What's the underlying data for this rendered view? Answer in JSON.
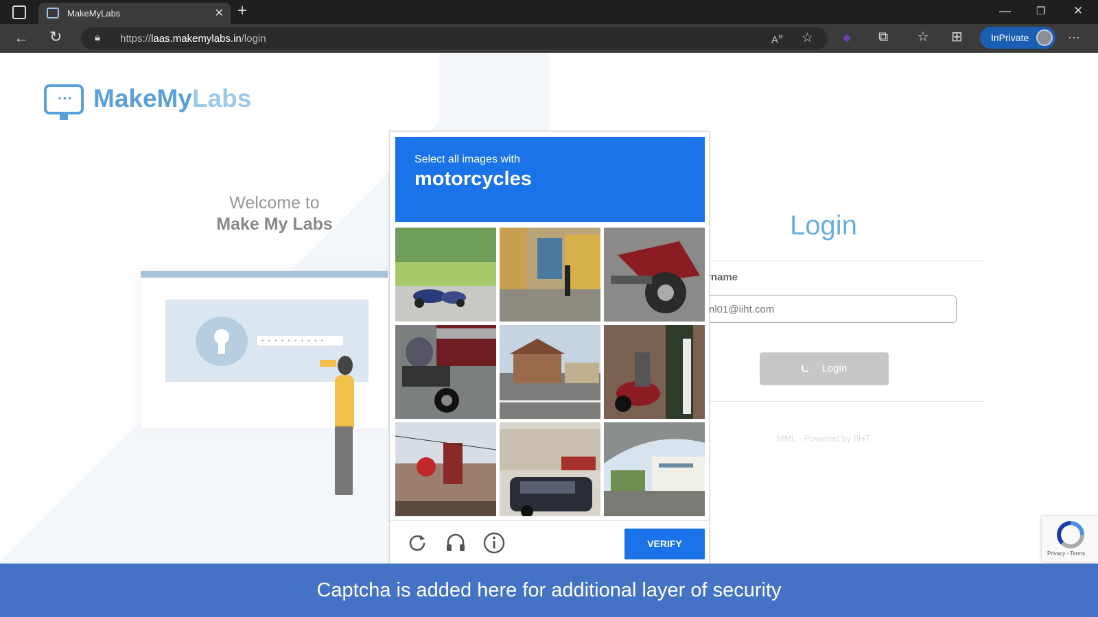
{
  "browser": {
    "tab_title": "MakeMyLabs",
    "url_prefix": "https://",
    "url_domain": "laas.makemylabs.in",
    "url_path": "/login",
    "inprivate_label": "InPrivate",
    "accent_color": "#1a5fb4"
  },
  "page": {
    "logo_text_a": "MakeMy",
    "logo_text_b": "Labs",
    "welcome_line1": "Welcome to",
    "welcome_line2": "Make My Labs",
    "illus_password_mask": "• • • • • • • • • •",
    "login_title": "Login",
    "username_label": "rname",
    "username_value": "nl01@iiht.com",
    "login_button": "Login",
    "powered_by": "MML - Powered by IIHT"
  },
  "captcha": {
    "instruction": "Select all images with",
    "target": "motorcycles",
    "verify_label": "VERIFY",
    "header_color": "#1a73e8",
    "tiles": [
      {
        "scene": "park with motorcycles"
      },
      {
        "scene": "alley with mural"
      },
      {
        "scene": "red motorcycle close-up"
      },
      {
        "scene": "motorcycle in traffic"
      },
      {
        "scene": "roadside houses"
      },
      {
        "scene": "parked scooter by wall"
      },
      {
        "scene": "shop signs street"
      },
      {
        "scene": "car in front of shops"
      },
      {
        "scene": "overpass and building"
      }
    ]
  },
  "recaptcha_badge": {
    "terms": "Privacy - Terms"
  },
  "caption": "Captcha is added here for additional layer of security"
}
